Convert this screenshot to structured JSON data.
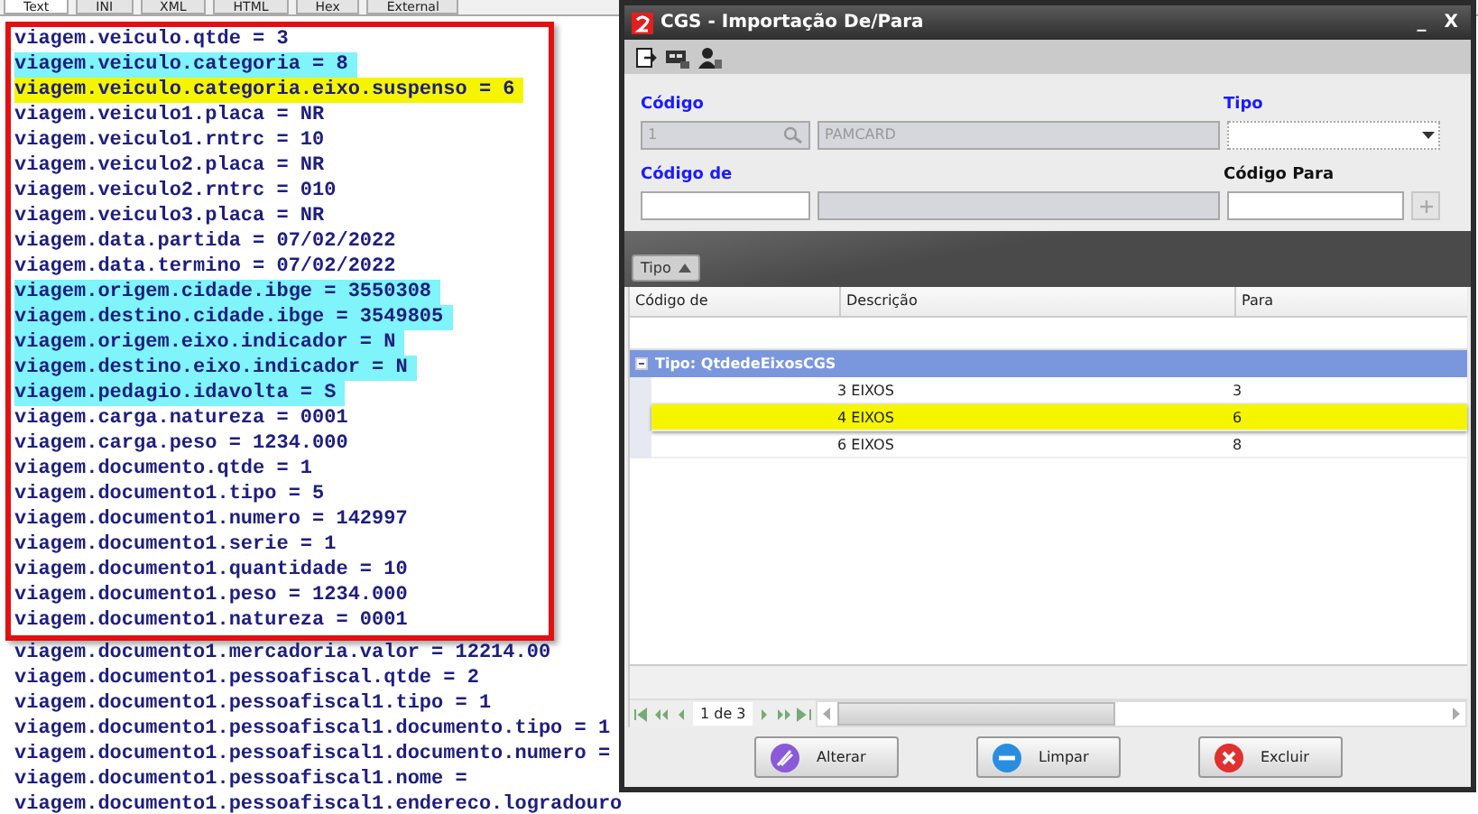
{
  "tabs": [
    {
      "label": "Text",
      "selected": true
    },
    {
      "label": "INI",
      "selected": false
    },
    {
      "label": "XML",
      "selected": false
    },
    {
      "label": "HTML",
      "selected": false
    },
    {
      "label": "Hex",
      "selected": false
    },
    {
      "label": "External",
      "selected": false
    }
  ],
  "editor": {
    "framed_lines": [
      {
        "text": "viagem.veiculo.qtde = 3"
      },
      {
        "text": "viagem.veiculo.categoria = 8",
        "color": "#7ff4fb"
      },
      {
        "text": "viagem.veiculo.categoria.eixo.suspenso = 6",
        "color": "#f5f500"
      },
      {
        "text": "viagem.veiculo1.placa = NR"
      },
      {
        "text": "viagem.veiculo1.rntrc = 10"
      },
      {
        "text": "viagem.veiculo2.placa = NR"
      },
      {
        "text": "viagem.veiculo2.rntrc = 010"
      },
      {
        "text": "viagem.veiculo3.placa = NR"
      },
      {
        "text": "viagem.data.partida = 07/02/2022"
      },
      {
        "text": "viagem.data.termino = 07/02/2022"
      },
      {
        "text": "viagem.origem.cidade.ibge = 3550308",
        "color": "#7ff4fb"
      },
      {
        "text": "viagem.destino.cidade.ibge = 3549805",
        "color": "#7ff4fb"
      },
      {
        "text": "viagem.origem.eixo.indicador = N",
        "color": "#7ff4fb"
      },
      {
        "text": "viagem.destino.eixo.indicador = N",
        "color": "#7ff4fb"
      },
      {
        "text": "viagem.pedagio.idavolta = S",
        "color": "#7ff4fb"
      },
      {
        "text": "viagem.carga.natureza = 0001"
      },
      {
        "text": "viagem.carga.peso = 1234.000"
      },
      {
        "text": "viagem.documento.qtde = 1"
      },
      {
        "text": "viagem.documento1.tipo = 5"
      },
      {
        "text": "viagem.documento1.numero = 142997"
      },
      {
        "text": "viagem.documento1.serie = 1"
      },
      {
        "text": "viagem.documento1.quantidade = 10"
      },
      {
        "text": "viagem.documento1.peso = 1234.000"
      },
      {
        "text": "viagem.documento1.natureza = 0001"
      }
    ],
    "lines": [
      {
        "text": "viagem.documento1.mercadoria.valor = 12214.00"
      },
      {
        "text": "viagem.documento1.pessoafiscal.qtde = 2"
      },
      {
        "text": "viagem.documento1.pessoafiscal1.tipo = 1"
      },
      {
        "text": "viagem.documento1.pessoafiscal1.documento.tipo = 1"
      },
      {
        "text": "viagem.documento1.pessoafiscal1.documento.numero ="
      },
      {
        "text": "viagem.documento1.pessoafiscal1.nome ="
      },
      {
        "text": "viagem.documento1.pessoafiscal1.endereco.logradouro"
      }
    ]
  },
  "dialog": {
    "title": "CGS - Importação De/Para",
    "minimize": "_",
    "close": "X",
    "fields": [
      {
        "label": "Código",
        "required": true,
        "disabled": true,
        "value": "1",
        "name": "PAMCARD"
      },
      {
        "label": "Tipo",
        "required": true,
        "disabled": false
      },
      {
        "label": "Código de",
        "required": true,
        "disabled": false
      },
      {
        "label": "Código Para",
        "required": false,
        "disabled": false
      }
    ],
    "group_chip": "Tipo",
    "columns": [
      "Código de",
      "Descrição",
      "Para"
    ],
    "group": {
      "label": "Tipo: QtdedeEixosCGS",
      "expanded": true
    },
    "rows": [
      {
        "descricao": "3 EIXOS",
        "para": "3",
        "selected": false
      },
      {
        "descricao": "4 EIXOS",
        "para": "6",
        "selected": true
      },
      {
        "descricao": "6 EIXOS",
        "para": "8",
        "selected": false
      }
    ],
    "pager": "1 de 3",
    "buttons": [
      {
        "label": "Alterar",
        "kind": "edit"
      },
      {
        "label": "Limpar",
        "kind": "clear"
      },
      {
        "label": "Excluir",
        "kind": "delete"
      }
    ]
  }
}
